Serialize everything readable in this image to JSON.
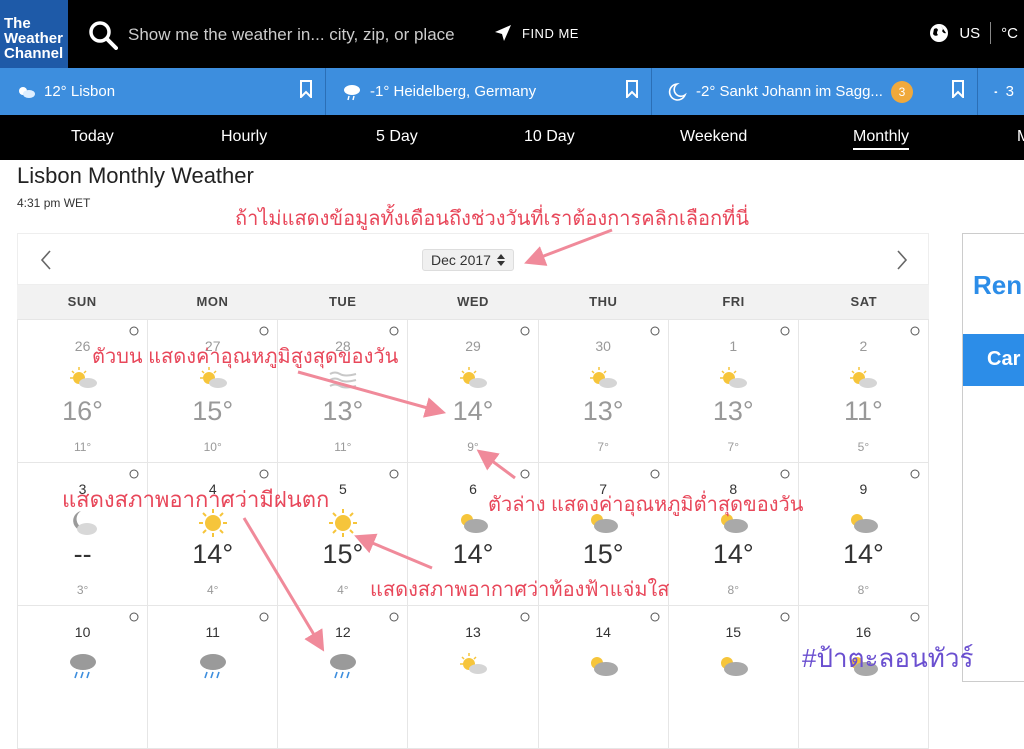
{
  "brand": {
    "logo_line1": "The",
    "logo_line2": "Weather",
    "logo_line3": "Channel"
  },
  "search": {
    "placeholder": "Show me the weather in... city, zip, or place"
  },
  "find_me": "FIND ME",
  "locale": {
    "region": "US",
    "unit": "°C"
  },
  "saved_locations": [
    {
      "label": "12° Lisbon",
      "icon": "partly-sunny-icon"
    },
    {
      "label": "-1° Heidelberg, Germany",
      "icon": "cloud-rain-icon"
    },
    {
      "label": "-2° Sankt Johann im Sagg...",
      "icon": "moon-cloud-icon",
      "badge": "3"
    },
    {
      "label": "3",
      "icon": "cloud-icon"
    }
  ],
  "nav": {
    "tabs": [
      "Today",
      "Hourly",
      "5 Day",
      "10 Day",
      "Weekend",
      "Monthly",
      "M"
    ],
    "active": "Monthly"
  },
  "page": {
    "title": "Lisbon Monthly Weather",
    "time": "4:31 pm WET"
  },
  "calendar": {
    "month": "Dec 2017",
    "weekdays": [
      "SUN",
      "MON",
      "TUE",
      "WED",
      "THU",
      "FRI",
      "SAT"
    ],
    "days": [
      {
        "day": "26",
        "hi": "16°",
        "lo": "11°",
        "wx": "partly-sunny",
        "past": true
      },
      {
        "day": "27",
        "hi": "15°",
        "lo": "10°",
        "wx": "partly-sunny",
        "past": true
      },
      {
        "day": "28",
        "hi": "13°",
        "lo": "11°",
        "wx": "fog",
        "past": true
      },
      {
        "day": "29",
        "hi": "14°",
        "lo": "9°",
        "wx": "partly-sunny",
        "past": true
      },
      {
        "day": "30",
        "hi": "13°",
        "lo": "7°",
        "wx": "partly-sunny",
        "past": true
      },
      {
        "day": "1",
        "hi": "13°",
        "lo": "7°",
        "wx": "partly-sunny",
        "past": true
      },
      {
        "day": "2",
        "hi": "11°",
        "lo": "5°",
        "wx": "partly-sunny",
        "past": true
      },
      {
        "day": "3",
        "hi": "--",
        "lo": "3°",
        "wx": "moon-cloud",
        "past": false
      },
      {
        "day": "4",
        "hi": "14°",
        "lo": "4°",
        "wx": "sunny",
        "past": false
      },
      {
        "day": "5",
        "hi": "15°",
        "lo": "4°",
        "wx": "sunny",
        "past": false
      },
      {
        "day": "6",
        "hi": "14°",
        "lo": "",
        "wx": "partly-cloudy",
        "past": false
      },
      {
        "day": "7",
        "hi": "15°",
        "lo": "",
        "wx": "partly-cloudy",
        "past": false
      },
      {
        "day": "8",
        "hi": "14°",
        "lo": "8°",
        "wx": "partly-cloudy",
        "past": false
      },
      {
        "day": "9",
        "hi": "14°",
        "lo": "8°",
        "wx": "partly-cloudy",
        "past": false
      },
      {
        "day": "10",
        "hi": "",
        "lo": "",
        "wx": "rain",
        "past": false
      },
      {
        "day": "11",
        "hi": "",
        "lo": "",
        "wx": "rain",
        "past": false
      },
      {
        "day": "12",
        "hi": "",
        "lo": "",
        "wx": "rain",
        "past": false
      },
      {
        "day": "13",
        "hi": "",
        "lo": "",
        "wx": "partly-sunny",
        "past": false
      },
      {
        "day": "14",
        "hi": "",
        "lo": "",
        "wx": "partly-cloudy",
        "past": false
      },
      {
        "day": "15",
        "hi": "",
        "lo": "",
        "wx": "partly-cloudy",
        "past": false
      },
      {
        "day": "16",
        "hi": "",
        "lo": "",
        "wx": "partly-cloudy",
        "past": false
      }
    ]
  },
  "ad": {
    "text": "Ren",
    "button": "Car"
  },
  "annotations": {
    "select_month": "ถ้าไม่แสดงข้อมูลทั้งเดือนถึงช่วงวันที่เราต้องการคลิกเลือกที่นี่",
    "top_value": "ตัวบน แสดงค่าอุณหภูมิสูงสุดของวัน",
    "bottom_value": "ตัวล่าง แสดงค่าอุณหภูมิต่ำสุดของวัน",
    "rain": "แสดงสภาพอากาศว่ามีฝนตก",
    "clear": "แสดงสภาพอากาศว่าท้องฟ้าแจ่มใส",
    "hashtag": "#ป้าตะลอนทัวร์"
  },
  "colors": {
    "accent_blue": "#3d8ede",
    "annotation_red": "#e8475a",
    "hashtag_purple": "#6a4fd0"
  }
}
